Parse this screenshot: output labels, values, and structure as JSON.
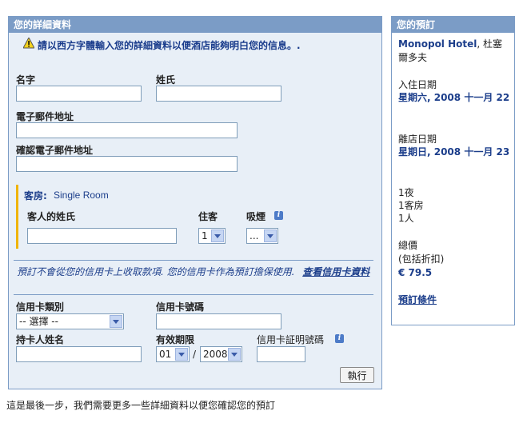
{
  "details": {
    "header": "您的詳細資料",
    "warning": "請以西方字體輸入您的詳細資料以便酒店能夠明白您的信息。.",
    "first_name_label": "名字",
    "last_name_label": "姓氏",
    "email_label": "電子郵件地址",
    "confirm_email_label": "確認電子郵件地址",
    "room_prefix": "客房:",
    "room_type": "Single Room",
    "guest_name_label": "客人的姓氏",
    "occupants_label": "住客",
    "occupants_value": "1",
    "smoking_label": "吸煙",
    "smoking_value": "...",
    "card_notice": "預訂不會從您的信用卡上收取款項. 您的信用卡作為預訂擔保使用.",
    "card_info_link": "查看信用卡資料",
    "card_type_label": "信用卡類別",
    "card_type_value": "-- 選擇 --",
    "card_number_label": "信用卡號碼",
    "holder_label": "持卡人姓名",
    "expiry_label": "有效期限",
    "expiry_month": "01",
    "expiry_sep": "/",
    "expiry_year": "2008",
    "cvv_label": "信用卡証明號碼",
    "submit_label": "執行"
  },
  "booking": {
    "header": "您的預訂",
    "hotel_name": "Monopol Hotel",
    "hotel_city": ", 杜塞爾多夫",
    "checkin_label": "入住日期",
    "checkin_date": "星期六, 2008 十一月 22",
    "checkout_label": "離店日期",
    "checkout_date": "星期日, 2008 十一月 23",
    "nights": "1夜",
    "rooms": "1客房",
    "persons": "1人",
    "total_label": "總價",
    "discount_note": "(包括折扣)",
    "price": "€ 79.5",
    "terms_link": "預訂條件"
  },
  "footer_text": "這是最後一步，我們需要更多一些詳細資料以便您確認您的預訂",
  "colors": {
    "panel_header": "#7b9cc6",
    "panel_bg": "#e8eff7",
    "link": "#1c3e8b",
    "accent": "#f0b400"
  }
}
